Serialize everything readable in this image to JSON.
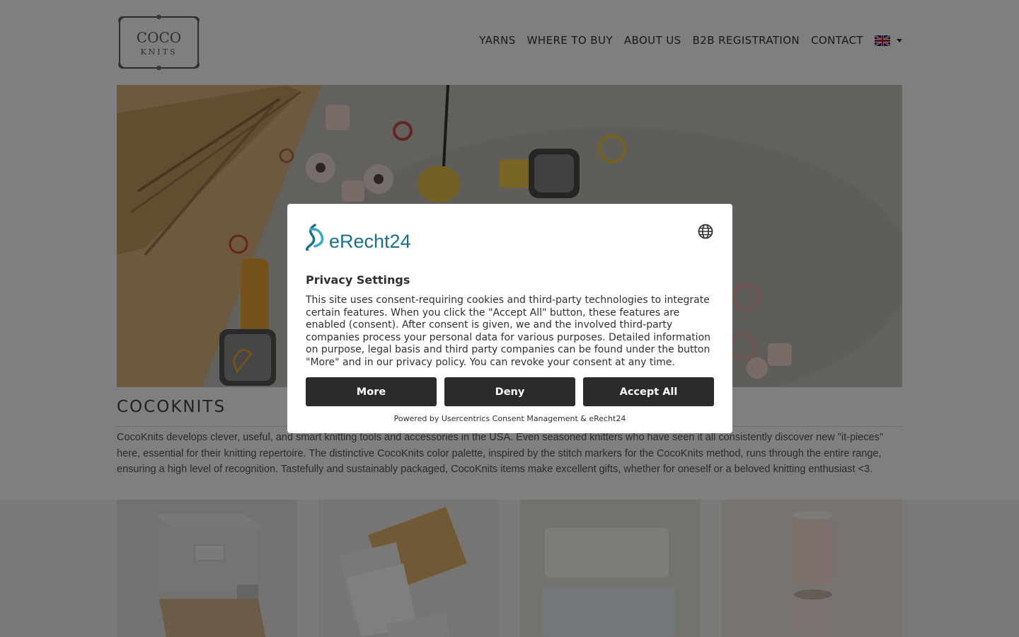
{
  "header": {
    "logo_line1": "COCO",
    "logo_line2": "KNITS",
    "nav": [
      {
        "label": "YARNS"
      },
      {
        "label": "WHERE TO BUY"
      },
      {
        "label": "ABOUT US"
      },
      {
        "label": "B2B REGISTRATION"
      },
      {
        "label": "CONTACT"
      }
    ],
    "language_icon": "uk-flag-icon"
  },
  "about": {
    "title": "COCOKNITS",
    "text": "CocoKnits develops clever, useful, and smart knitting tools and accessories in the USA. Even seasoned knitters who have seen it all consistently discover new \"it-pieces\" here, essential for their knitting repertoire. The distinctive CocoKnits color palette, inspired by the stitch markers for the CocoKnits method, runs through the entire range, ensuring a high level of recognition. Tastefully and sustainably packaged, CocoKnits items make excellent gifts, whether for oneself or a beloved knitting enthusiast <3."
  },
  "consent": {
    "brand": "eRecht24",
    "title": "Privacy Settings",
    "body": "This site uses consent-requiring cookies and third-party technologies to integrate certain features. When you click the \"Accept All\" button, these features are enabled (consent). After consent is given, we and the involved third-party companies process your personal data for various purposes. Detailed information on purpose, legal basis and third party companies can be found under the button \"More\" and in our privacy policy. You can revoke your consent at any time.",
    "buttons": {
      "more": "More",
      "deny": "Deny",
      "accept": "Accept All"
    },
    "powered_by": "Powered by Usercentrics Consent Management & eRecht24"
  },
  "colors": {
    "brand_teal": "#1b6f8a",
    "button_dark": "#2b2b2b",
    "overlay": "rgba(0,0,0,0.5)"
  }
}
